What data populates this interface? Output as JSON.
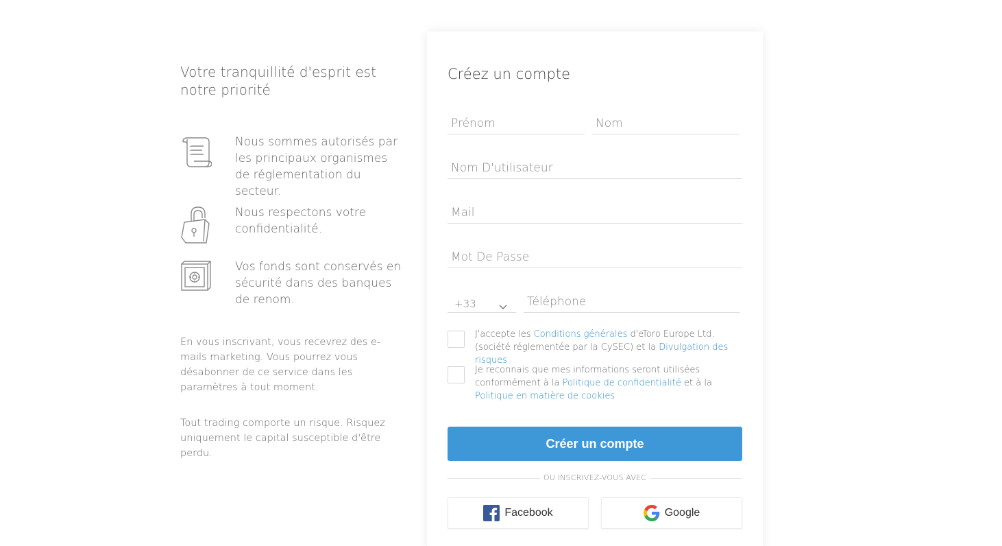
{
  "left": {
    "headline": "Votre tranquillité d'esprit est notre priorité",
    "features": [
      {
        "icon": "scroll-icon",
        "text": "Nous sommes autorisés par les principaux organismes de réglementation du secteur."
      },
      {
        "icon": "padlock-icon",
        "text": "Nous respectons votre confidentialité."
      },
      {
        "icon": "safe-icon",
        "text": "Vos fonds sont conservés en sécurité dans des banques de renom."
      }
    ],
    "notes": [
      "En vous inscrivant, vous recevrez des e-mails marketing. Vous pourrez vous désabonner de ce service dans les paramètres à tout moment.",
      "Tout trading comporte un risque. Risquez uniquement le capital susceptible d'être perdu."
    ]
  },
  "form": {
    "title": "Créez un compte",
    "first_name_placeholder": "Prénom",
    "last_name_placeholder": "Nom",
    "username_placeholder": "Nom D'utilisateur",
    "email_placeholder": "Mail",
    "password_placeholder": "Mot De Passe",
    "country_code": "+33",
    "phone_placeholder": "Téléphone",
    "terms": {
      "prefix": "J'accepte les ",
      "link1": "Conditions générales",
      "middle": " d'eToro Europe Ltd. (société réglementée par la CySEC) et la ",
      "link2": "Divulgation des risques"
    },
    "privacy": {
      "prefix": "Je reconnais que mes informations seront utilisées conformément à la ",
      "link1": "Politique de confidentialité",
      "middle": " et à la ",
      "link2": "Politique en matière de cookies"
    },
    "submit_label": "Créer un compte",
    "divider_text": "OU INSCRIVEZ-VOUS AVEC",
    "facebook_label": "Facebook",
    "google_label": "Google"
  },
  "colors": {
    "accent": "#3e98d8",
    "link": "#2a8bd0",
    "facebook": "#3b5998"
  }
}
